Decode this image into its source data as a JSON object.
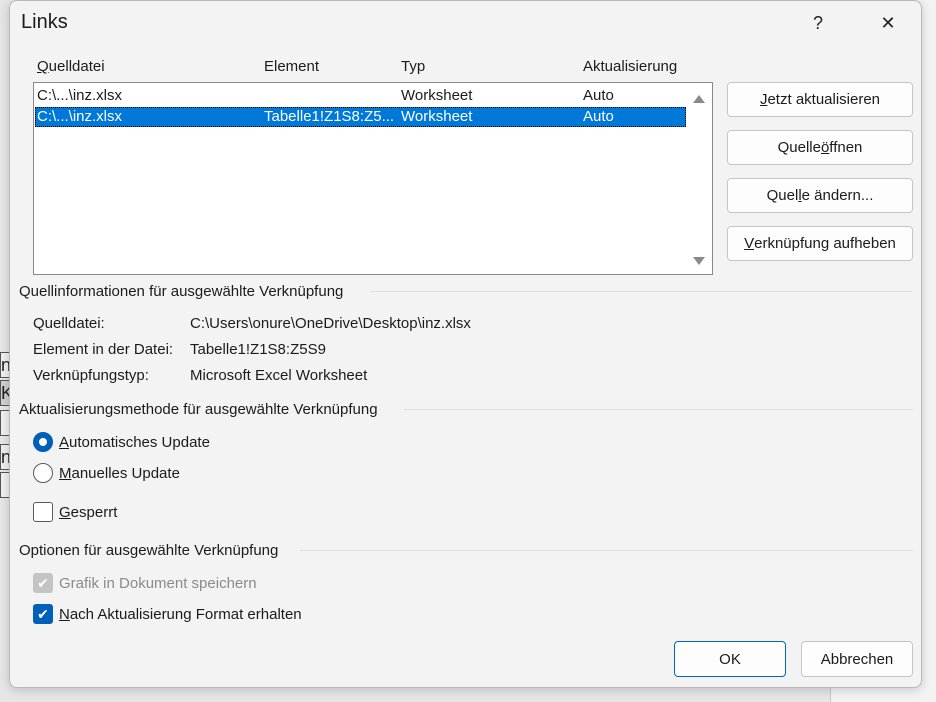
{
  "dialog": {
    "title": "Links",
    "help_glyph": "?",
    "close_glyph": "✕"
  },
  "columns": {
    "source_prefix": "Q",
    "source_rest": "uelldatei",
    "element": "Element",
    "type": "Typ",
    "update": "Aktualisierung"
  },
  "links": [
    {
      "source": "C:\\...\\inz.xlsx",
      "element": "",
      "type": "Worksheet",
      "update": "Auto",
      "selected": false
    },
    {
      "source": "C:\\...\\inz.xlsx",
      "element": "Tabelle1!Z1S8:Z5...",
      "type": "Worksheet",
      "update": "Auto",
      "selected": true
    }
  ],
  "buttons": {
    "update_now": {
      "pre": "",
      "u": "J",
      "post": "etzt aktualisieren"
    },
    "open_source": {
      "pre": "Quelle ",
      "u": "ö",
      "post": "ffnen"
    },
    "change_source": {
      "pre": "Quel",
      "u": "l",
      "post": "e ändern..."
    },
    "break_link": {
      "pre": "",
      "u": "V",
      "post": "erknüpfung aufheben"
    },
    "ok": "OK",
    "cancel": "Abbrechen"
  },
  "source_info": {
    "heading": "Quellinformationen für ausgewählte Verknüpfung",
    "file_label": "Quelldatei:",
    "file_value": "C:\\Users\\onure\\OneDrive\\Desktop\\inz.xlsx",
    "element_label": "Element in der Datei:",
    "element_value": "Tabelle1!Z1S8:Z5S9",
    "type_label": "Verknüpfungstyp:",
    "type_value": "Microsoft Excel Worksheet"
  },
  "update_method": {
    "heading": "Aktualisierungsmethode für ausgewählte Verknüpfung",
    "auto": {
      "u": "A",
      "post": "utomatisches Update",
      "checked": true
    },
    "manual": {
      "u": "M",
      "post": "anuelles Update",
      "checked": false
    },
    "locked": {
      "u": "G",
      "post": "esperrt",
      "checked": false
    }
  },
  "options": {
    "heading": "Optionen für ausgewählte Verknüpfung",
    "save_graphic": {
      "label": "Grafik in Dokument speichern",
      "checked": true,
      "disabled": true
    },
    "keep_format": {
      "u": "N",
      "post": "ach Aktualisierung Format erhalten",
      "checked": true
    }
  },
  "background_fragments": [
    "na",
    "KV",
    "ne"
  ],
  "colors": {
    "accent": "#005fb8",
    "selection": "#0078d7"
  }
}
